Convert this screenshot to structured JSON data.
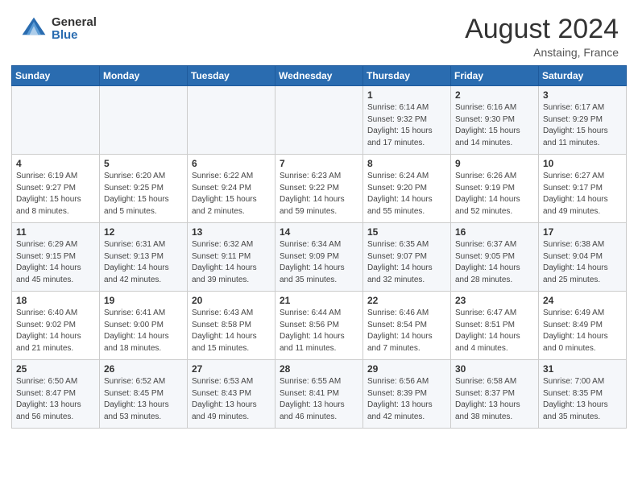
{
  "header": {
    "logo_general": "General",
    "logo_blue": "Blue",
    "month_title": "August 2024",
    "location": "Anstaing, France"
  },
  "calendar": {
    "weekdays": [
      "Sunday",
      "Monday",
      "Tuesday",
      "Wednesday",
      "Thursday",
      "Friday",
      "Saturday"
    ],
    "weeks": [
      [
        {
          "day": "",
          "info": ""
        },
        {
          "day": "",
          "info": ""
        },
        {
          "day": "",
          "info": ""
        },
        {
          "day": "",
          "info": ""
        },
        {
          "day": "1",
          "info": "Sunrise: 6:14 AM\nSunset: 9:32 PM\nDaylight: 15 hours\nand 17 minutes."
        },
        {
          "day": "2",
          "info": "Sunrise: 6:16 AM\nSunset: 9:30 PM\nDaylight: 15 hours\nand 14 minutes."
        },
        {
          "day": "3",
          "info": "Sunrise: 6:17 AM\nSunset: 9:29 PM\nDaylight: 15 hours\nand 11 minutes."
        }
      ],
      [
        {
          "day": "4",
          "info": "Sunrise: 6:19 AM\nSunset: 9:27 PM\nDaylight: 15 hours\nand 8 minutes."
        },
        {
          "day": "5",
          "info": "Sunrise: 6:20 AM\nSunset: 9:25 PM\nDaylight: 15 hours\nand 5 minutes."
        },
        {
          "day": "6",
          "info": "Sunrise: 6:22 AM\nSunset: 9:24 PM\nDaylight: 15 hours\nand 2 minutes."
        },
        {
          "day": "7",
          "info": "Sunrise: 6:23 AM\nSunset: 9:22 PM\nDaylight: 14 hours\nand 59 minutes."
        },
        {
          "day": "8",
          "info": "Sunrise: 6:24 AM\nSunset: 9:20 PM\nDaylight: 14 hours\nand 55 minutes."
        },
        {
          "day": "9",
          "info": "Sunrise: 6:26 AM\nSunset: 9:19 PM\nDaylight: 14 hours\nand 52 minutes."
        },
        {
          "day": "10",
          "info": "Sunrise: 6:27 AM\nSunset: 9:17 PM\nDaylight: 14 hours\nand 49 minutes."
        }
      ],
      [
        {
          "day": "11",
          "info": "Sunrise: 6:29 AM\nSunset: 9:15 PM\nDaylight: 14 hours\nand 45 minutes."
        },
        {
          "day": "12",
          "info": "Sunrise: 6:31 AM\nSunset: 9:13 PM\nDaylight: 14 hours\nand 42 minutes."
        },
        {
          "day": "13",
          "info": "Sunrise: 6:32 AM\nSunset: 9:11 PM\nDaylight: 14 hours\nand 39 minutes."
        },
        {
          "day": "14",
          "info": "Sunrise: 6:34 AM\nSunset: 9:09 PM\nDaylight: 14 hours\nand 35 minutes."
        },
        {
          "day": "15",
          "info": "Sunrise: 6:35 AM\nSunset: 9:07 PM\nDaylight: 14 hours\nand 32 minutes."
        },
        {
          "day": "16",
          "info": "Sunrise: 6:37 AM\nSunset: 9:05 PM\nDaylight: 14 hours\nand 28 minutes."
        },
        {
          "day": "17",
          "info": "Sunrise: 6:38 AM\nSunset: 9:04 PM\nDaylight: 14 hours\nand 25 minutes."
        }
      ],
      [
        {
          "day": "18",
          "info": "Sunrise: 6:40 AM\nSunset: 9:02 PM\nDaylight: 14 hours\nand 21 minutes."
        },
        {
          "day": "19",
          "info": "Sunrise: 6:41 AM\nSunset: 9:00 PM\nDaylight: 14 hours\nand 18 minutes."
        },
        {
          "day": "20",
          "info": "Sunrise: 6:43 AM\nSunset: 8:58 PM\nDaylight: 14 hours\nand 15 minutes."
        },
        {
          "day": "21",
          "info": "Sunrise: 6:44 AM\nSunset: 8:56 PM\nDaylight: 14 hours\nand 11 minutes."
        },
        {
          "day": "22",
          "info": "Sunrise: 6:46 AM\nSunset: 8:54 PM\nDaylight: 14 hours\nand 7 minutes."
        },
        {
          "day": "23",
          "info": "Sunrise: 6:47 AM\nSunset: 8:51 PM\nDaylight: 14 hours\nand 4 minutes."
        },
        {
          "day": "24",
          "info": "Sunrise: 6:49 AM\nSunset: 8:49 PM\nDaylight: 14 hours\nand 0 minutes."
        }
      ],
      [
        {
          "day": "25",
          "info": "Sunrise: 6:50 AM\nSunset: 8:47 PM\nDaylight: 13 hours\nand 56 minutes."
        },
        {
          "day": "26",
          "info": "Sunrise: 6:52 AM\nSunset: 8:45 PM\nDaylight: 13 hours\nand 53 minutes."
        },
        {
          "day": "27",
          "info": "Sunrise: 6:53 AM\nSunset: 8:43 PM\nDaylight: 13 hours\nand 49 minutes."
        },
        {
          "day": "28",
          "info": "Sunrise: 6:55 AM\nSunset: 8:41 PM\nDaylight: 13 hours\nand 46 minutes."
        },
        {
          "day": "29",
          "info": "Sunrise: 6:56 AM\nSunset: 8:39 PM\nDaylight: 13 hours\nand 42 minutes."
        },
        {
          "day": "30",
          "info": "Sunrise: 6:58 AM\nSunset: 8:37 PM\nDaylight: 13 hours\nand 38 minutes."
        },
        {
          "day": "31",
          "info": "Sunrise: 7:00 AM\nSunset: 8:35 PM\nDaylight: 13 hours\nand 35 minutes."
        }
      ]
    ]
  }
}
